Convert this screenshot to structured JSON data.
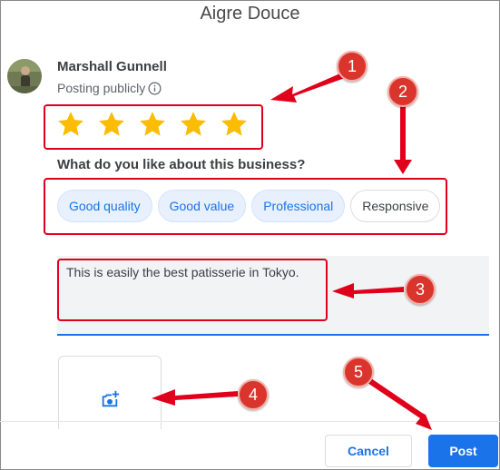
{
  "dialog": {
    "title": "Aigre Douce"
  },
  "user": {
    "name": "Marshall Gunnell",
    "visibility": "Posting publicly"
  },
  "rating": {
    "value": 5,
    "max": 5,
    "color": "#fbbc04"
  },
  "question": "What do you like about this business?",
  "chips": [
    {
      "label": "Good quality",
      "selected": true
    },
    {
      "label": "Good value",
      "selected": true
    },
    {
      "label": "Professional",
      "selected": true
    },
    {
      "label": "Responsive",
      "selected": false
    }
  ],
  "review": {
    "text": "This is easily the best patisserie in Tokyo."
  },
  "photo": {
    "icon": "add-photo-icon"
  },
  "actions": {
    "cancel": "Cancel",
    "post": "Post"
  },
  "annotations": {
    "color": "#e0001b",
    "badges": [
      "1",
      "2",
      "3",
      "4",
      "5"
    ]
  },
  "colors": {
    "accent": "#1a73e8",
    "star": "#fbbc04",
    "annotation": "#e0001b"
  }
}
